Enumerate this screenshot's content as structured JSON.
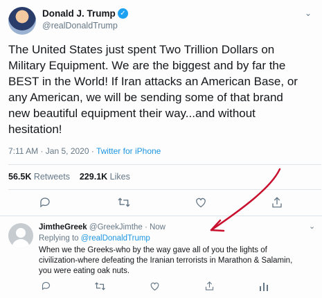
{
  "tweet": {
    "author_name": "Donald J. Trump",
    "author_handle": "@realDonaldTrump",
    "lines": [
      "The United States just spent Two Trillion Dollars on",
      "Military Equipment. We are the biggest and by far the",
      "BEST in the World! If Iran attacks an American Base, or",
      "any American, we will be sending some of that brand",
      "new beautiful equipment their way...and without",
      "hesitation!"
    ],
    "timestamp": "7:11 AM · Jan 5, 2020 · ",
    "source": "Twitter for iPhone",
    "retweets_count": "56.5K",
    "retweets_label": " Retweets",
    "likes_count": "229.1K",
    "likes_label": " Likes",
    "icons": [
      "reply-icon",
      "retweet-icon",
      "like-icon",
      "share-icon"
    ]
  },
  "reply": {
    "author_name": "JimtheGreek",
    "author_handle": "@GreekJimthe · Now",
    "replying_prefix": "Replying to ",
    "replying_handle": "@realDonaldTrump",
    "lines": [
      "When we the Greeks-who by the way gave all of you the lights of",
      "civilization-where defeating the Iranian terrorists in Marathon & Salamin,",
      "you were eating oak nuts."
    ],
    "icons": [
      "reply-icon",
      "retweet-icon",
      "like-icon",
      "share-icon",
      "analytics-icon"
    ]
  },
  "colors": {
    "verified": "#1da1f2",
    "link": "#1b95e0",
    "arrow": "#c8102e"
  }
}
